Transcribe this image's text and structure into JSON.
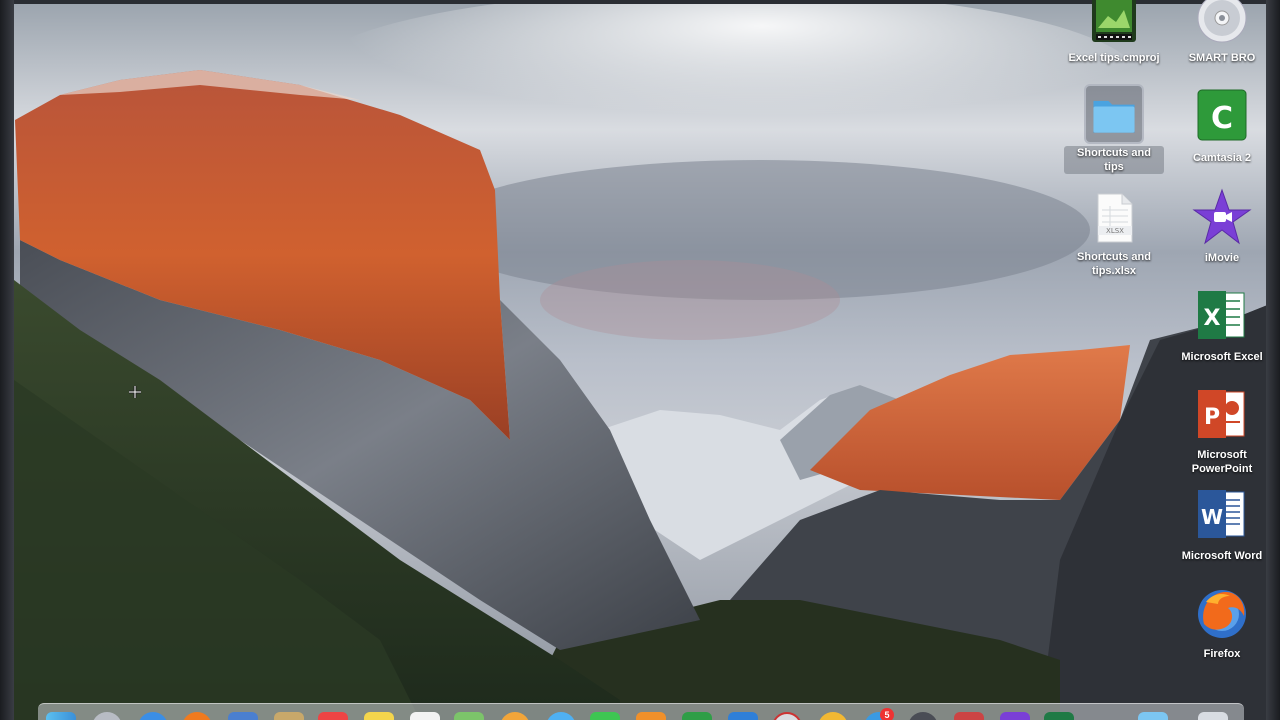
{
  "desktop": {
    "icons": [
      {
        "id": "excel-tips-cmproj",
        "label": "Excel tips.cmproj",
        "icon": "camtasia-project-icon"
      },
      {
        "id": "smart-bro",
        "label": "SMART BRO",
        "icon": "disc-drive-icon"
      },
      {
        "id": "shortcuts-folder",
        "label": "Shortcuts and tips",
        "icon": "folder-icon",
        "selected": true
      },
      {
        "id": "camtasia",
        "label": "Camtasia 2",
        "icon": "camtasia-icon"
      },
      {
        "id": "shortcuts-xlsx",
        "label": "Shortcuts and tips.xlsx",
        "icon": "xlsx-document-icon"
      },
      {
        "id": "imovie",
        "label": "iMovie",
        "icon": "imovie-icon"
      },
      {
        "id": "excel",
        "label": "Microsoft Excel",
        "icon": "excel-icon"
      },
      {
        "id": "powerpoint",
        "label": "Microsoft PowerPoint",
        "icon": "powerpoint-icon"
      },
      {
        "id": "word",
        "label": "Microsoft Word",
        "icon": "word-icon"
      },
      {
        "id": "firefox",
        "label": "Firefox",
        "icon": "firefox-icon"
      }
    ],
    "xlsx_badge": "XLSX"
  },
  "dock": {
    "items": [
      "finder-icon",
      "launchpad-icon",
      "safari-icon",
      "firefox-icon",
      "mail-icon",
      "notes-icon",
      "calendar-icon",
      "stickies-icon",
      "textedit-icon",
      "maps-icon",
      "photos-icon",
      "messages-icon",
      "facetime-icon",
      "ibooks-icon",
      "numbers-icon",
      "app-store-icon",
      "system-preferences-icon",
      "itunes-icon",
      "chrome-icon",
      "photo-booth-icon",
      "camtasia-icon",
      "imovie-icon",
      "excel-icon",
      "folder-icon",
      "trash-icon"
    ],
    "badge": "5"
  },
  "colors": {
    "folder_blue": "#63b8ec",
    "excel_green": "#1f7a45",
    "powerpoint_orange": "#d04727",
    "word_blue": "#2b579a",
    "camtasia_green": "#2e9a3a",
    "imovie_purple": "#7a3fd6"
  }
}
